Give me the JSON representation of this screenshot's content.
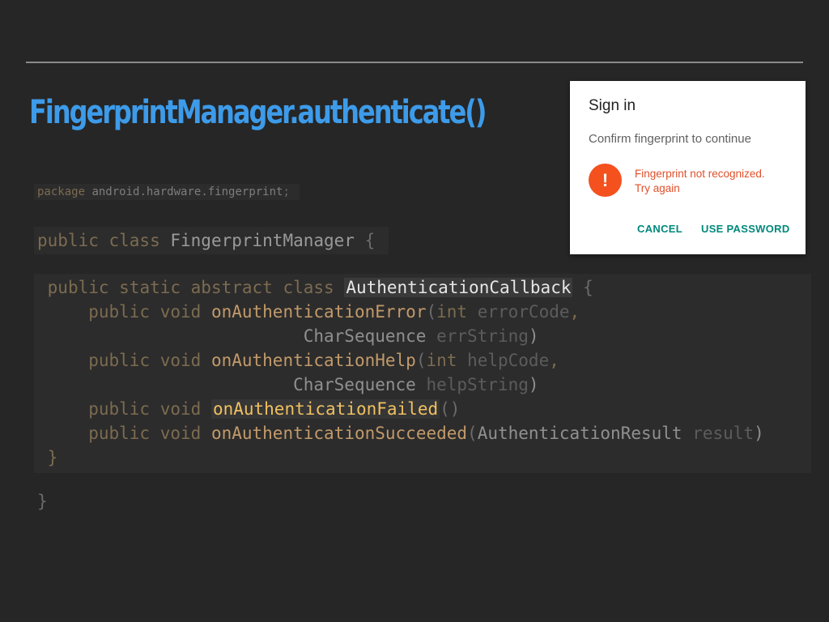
{
  "slide": {
    "title": "FingerprintManager.authenticate()"
  },
  "code": {
    "package_kw": "package",
    "package_name": "android.hardware.fingerprint",
    "package_semi": ";",
    "class_kw": "public class",
    "class_name": "FingerprintManager",
    "open_brace": "{",
    "inner_kw": "public static abstract class",
    "inner_name": "AuthenticationCallback",
    "inner_open": "{",
    "m1_kw": "public void",
    "m1_name": "onAuthenticationError",
    "m1_paren": "(",
    "m1_type1": "int",
    "m1_param1": "errorCode",
    "m1_comma": ",",
    "m1_type2": "CharSequence",
    "m1_param2": "errString",
    "m1_close": ")",
    "m2_kw": "public void",
    "m2_name": "onAuthenticationHelp",
    "m2_paren": "(",
    "m2_type1": "int",
    "m2_param1": "helpCode",
    "m2_comma": ",",
    "m2_type2": "CharSequence",
    "m2_param2": "helpString",
    "m2_close": ")",
    "m3_kw": "public void",
    "m3_name": "onAuthenticationFailed",
    "m3_parens": "()",
    "m4_kw": "public void",
    "m4_name": "onAuthenticationSucceeded",
    "m4_paren": "(",
    "m4_type": "AuthenticationResult",
    "m4_param": "result",
    "m4_close": ")",
    "inner_close": "}",
    "class_close": "}"
  },
  "dialog": {
    "title": "Sign in",
    "subtitle": "Confirm fingerprint to continue",
    "icon": "!",
    "error_line1": "Fingerprint not recognized.",
    "error_line2": "Try again",
    "cancel_label": "CANCEL",
    "use_password_label": "USE PASSWORD",
    "accent_color": "#00897b",
    "error_color": "#f4511e"
  }
}
